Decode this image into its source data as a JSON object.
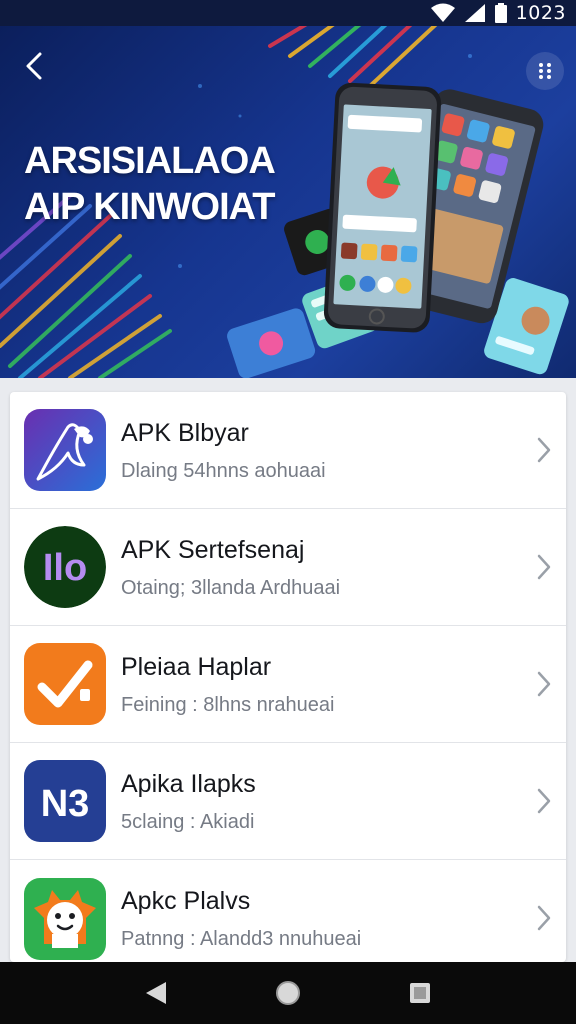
{
  "status_bar": {
    "time": "1023"
  },
  "hero": {
    "title_line1": "ARSISIALAOA",
    "title_line2": "AIP KINWOIAT"
  },
  "apps": [
    {
      "name": "APK Blbyar",
      "subtitle": "Dlaing 54hnns aohuaai",
      "icon": "pen-icon",
      "icon_bg": "#3b4aa8"
    },
    {
      "name": "APK Sertefsenaj",
      "subtitle": "Otaing; 3llanda Ardhuaai",
      "icon": "no-letters-icon",
      "icon_bg": "#0d3b12"
    },
    {
      "name": "Pleiaa Haplar",
      "subtitle": "Feining : 8lhns nrahueai",
      "icon": "checkmark-icon",
      "icon_bg": "#f27b1c"
    },
    {
      "name": "Apika Ilapks",
      "subtitle": "5claing : Akiadi",
      "icon": "n3-letters-icon",
      "icon_bg": "#253f94"
    },
    {
      "name": "Apkc Plalvs",
      "subtitle": "Patnng : Alandd3 nnuhueai",
      "icon": "mascot-icon",
      "icon_bg": "#2fb050"
    }
  ],
  "icon_texts": {
    "app2": "Ilo",
    "app4": "N3"
  },
  "colors": {
    "hero_bg": "#16358f",
    "status_bar_bg": "#0e1a3e",
    "nav_bar_bg": "#0a0a0a",
    "list_bg": "#ffffff",
    "page_bg": "#e9ebef"
  }
}
